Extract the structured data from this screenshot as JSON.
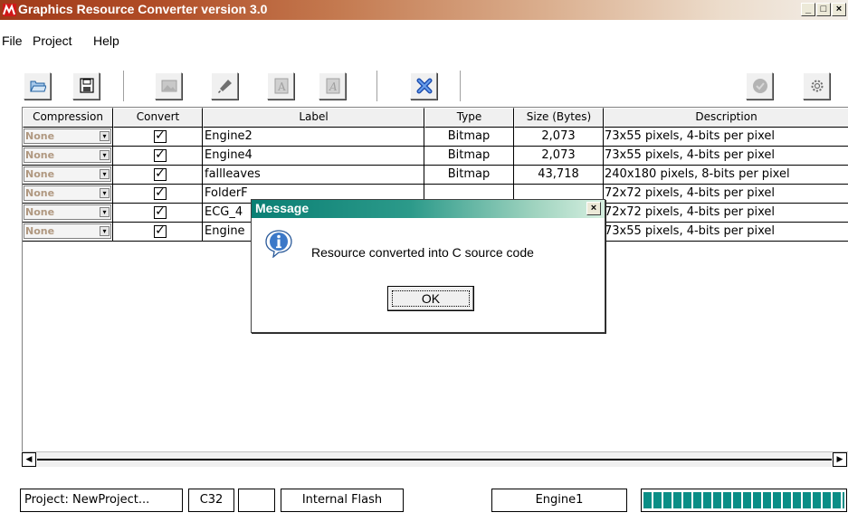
{
  "window": {
    "title": "Graphics Resource Converter version 3.0",
    "minimize": "_",
    "maximize": "□",
    "close": "×"
  },
  "menu": [
    "File",
    "Project",
    "Help"
  ],
  "toolbar": {
    "icons": [
      "open-folder-icon",
      "save-icon",
      "image-icon",
      "brush-icon",
      "font-icon",
      "font-edit-icon",
      "delete-icon",
      "check-circle-icon",
      "settings-icon"
    ]
  },
  "grid": {
    "columns": [
      "Compression",
      "Convert",
      "Label",
      "Type",
      "Size (Bytes)",
      "Description"
    ],
    "rows": [
      {
        "compression": "None",
        "convert": "✓",
        "label": "Engine2",
        "type": "Bitmap",
        "size": "2,073",
        "description": "73x55 pixels, 4-bits per pixel"
      },
      {
        "compression": "None",
        "convert": "✓",
        "label": "Engine4",
        "type": "Bitmap",
        "size": "2,073",
        "description": "73x55 pixels, 4-bits per pixel"
      },
      {
        "compression": "None",
        "convert": "✓",
        "label": "fallleaves",
        "type": "Bitmap",
        "size": "43,718",
        "description": "240x180 pixels, 8-bits per pixel"
      },
      {
        "compression": "None",
        "convert": "✓",
        "label": "FolderF",
        "type": "",
        "size": "",
        "description": "72x72 pixels, 4-bits per pixel"
      },
      {
        "compression": "None",
        "convert": "✓",
        "label": "ECG_4",
        "type": "",
        "size": "",
        "description": "72x72 pixels, 4-bits per pixel"
      },
      {
        "compression": "None",
        "convert": "✓",
        "label": "Engine",
        "type": "",
        "size": "",
        "description": "73x55 pixels, 4-bits per pixel"
      }
    ]
  },
  "status": {
    "project": "Project:  NewProject...",
    "compiler": "C32",
    "blank": "",
    "memory": "Internal Flash",
    "resource": "Engine1",
    "progress": 1.0
  },
  "dialog": {
    "title": "Message",
    "close": "×",
    "message": "Resource converted into C source code",
    "ok": "OK"
  },
  "colors": {
    "title_gradient_start": "#a03a1a",
    "dialog_title": "#0a7f74",
    "progress": "#0a8e86"
  }
}
